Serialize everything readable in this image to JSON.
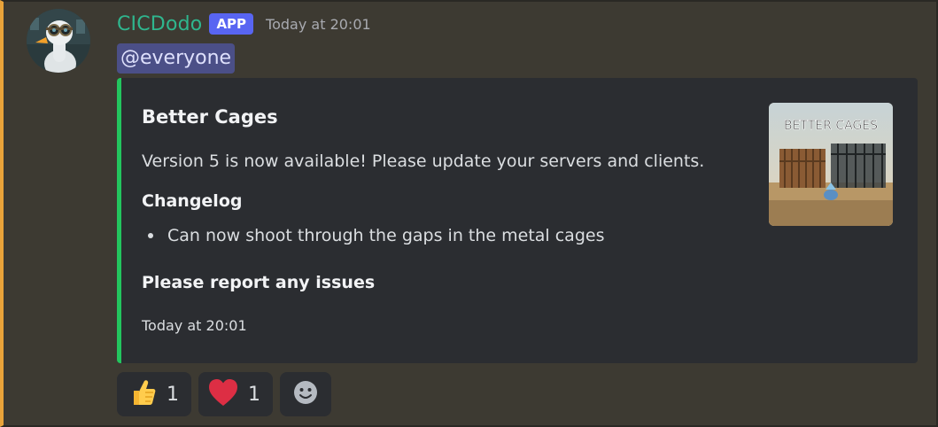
{
  "message": {
    "author": "CICDodo",
    "badge": "APP",
    "timestamp": "Today at 20:01",
    "mention": "@everyone",
    "author_color": "#2fb68e",
    "avatar_icon": "goose-avatar-icon"
  },
  "embed": {
    "accent_color": "#23c55e",
    "title": "Better Cages",
    "description": "Version 5 is now available! Please update your servers and clients.",
    "section_heading": "Changelog",
    "bullets": [
      "Can now shoot through the gaps in the metal cages"
    ],
    "report_text": "Please report any issues",
    "footer_timestamp": "Today at 20:01",
    "thumbnail": {
      "caption": "BETTER CAGES",
      "icon": "better-cages-thumbnail"
    }
  },
  "reactions": [
    {
      "emoji": "thumbs-up-icon",
      "count": "1"
    },
    {
      "emoji": "heart-icon",
      "count": "1"
    },
    {
      "emoji": "add-reaction-icon"
    }
  ]
}
